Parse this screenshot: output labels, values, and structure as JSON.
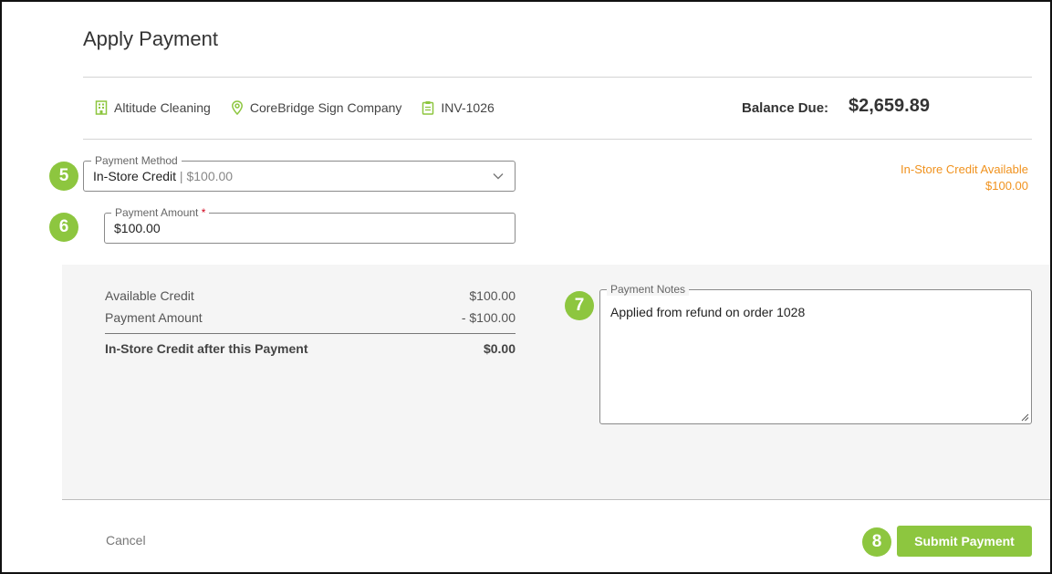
{
  "dialog": {
    "title": "Apply Payment"
  },
  "info": {
    "company": "Altitude Cleaning",
    "location": "CoreBridge Sign Company",
    "invoice": "INV-1026",
    "balance_label": "Balance Due:",
    "balance_value": "$2,659.89"
  },
  "steps": {
    "method": "5",
    "amount": "6",
    "notes": "7",
    "submit": "8"
  },
  "payment_method": {
    "legend": "Payment Method",
    "value": "In-Store Credit",
    "separator": " | ",
    "amount": "$100.00"
  },
  "credit_available": {
    "label": "In-Store Credit Available",
    "amount": "$100.00"
  },
  "payment_amount": {
    "legend": "Payment Amount",
    "required_mark": "*",
    "value": "$100.00"
  },
  "summary": {
    "rows": [
      {
        "label": "Available Credit",
        "value": "$100.00"
      },
      {
        "label": "Payment Amount",
        "value": "- $100.00"
      }
    ],
    "total": {
      "label": "In-Store Credit after this Payment",
      "value": "$0.00"
    }
  },
  "notes": {
    "legend": "Payment Notes",
    "value": "Applied from refund on order 1028"
  },
  "footer": {
    "cancel_label": "Cancel",
    "submit_label": "Submit Payment"
  },
  "colors": {
    "accent": "#8dc63f",
    "warning": "#f0921e"
  },
  "icons": {
    "company": "building-icon",
    "location": "map-pin-icon",
    "invoice": "clipboard-icon",
    "dropdown": "chevron-down-icon"
  }
}
